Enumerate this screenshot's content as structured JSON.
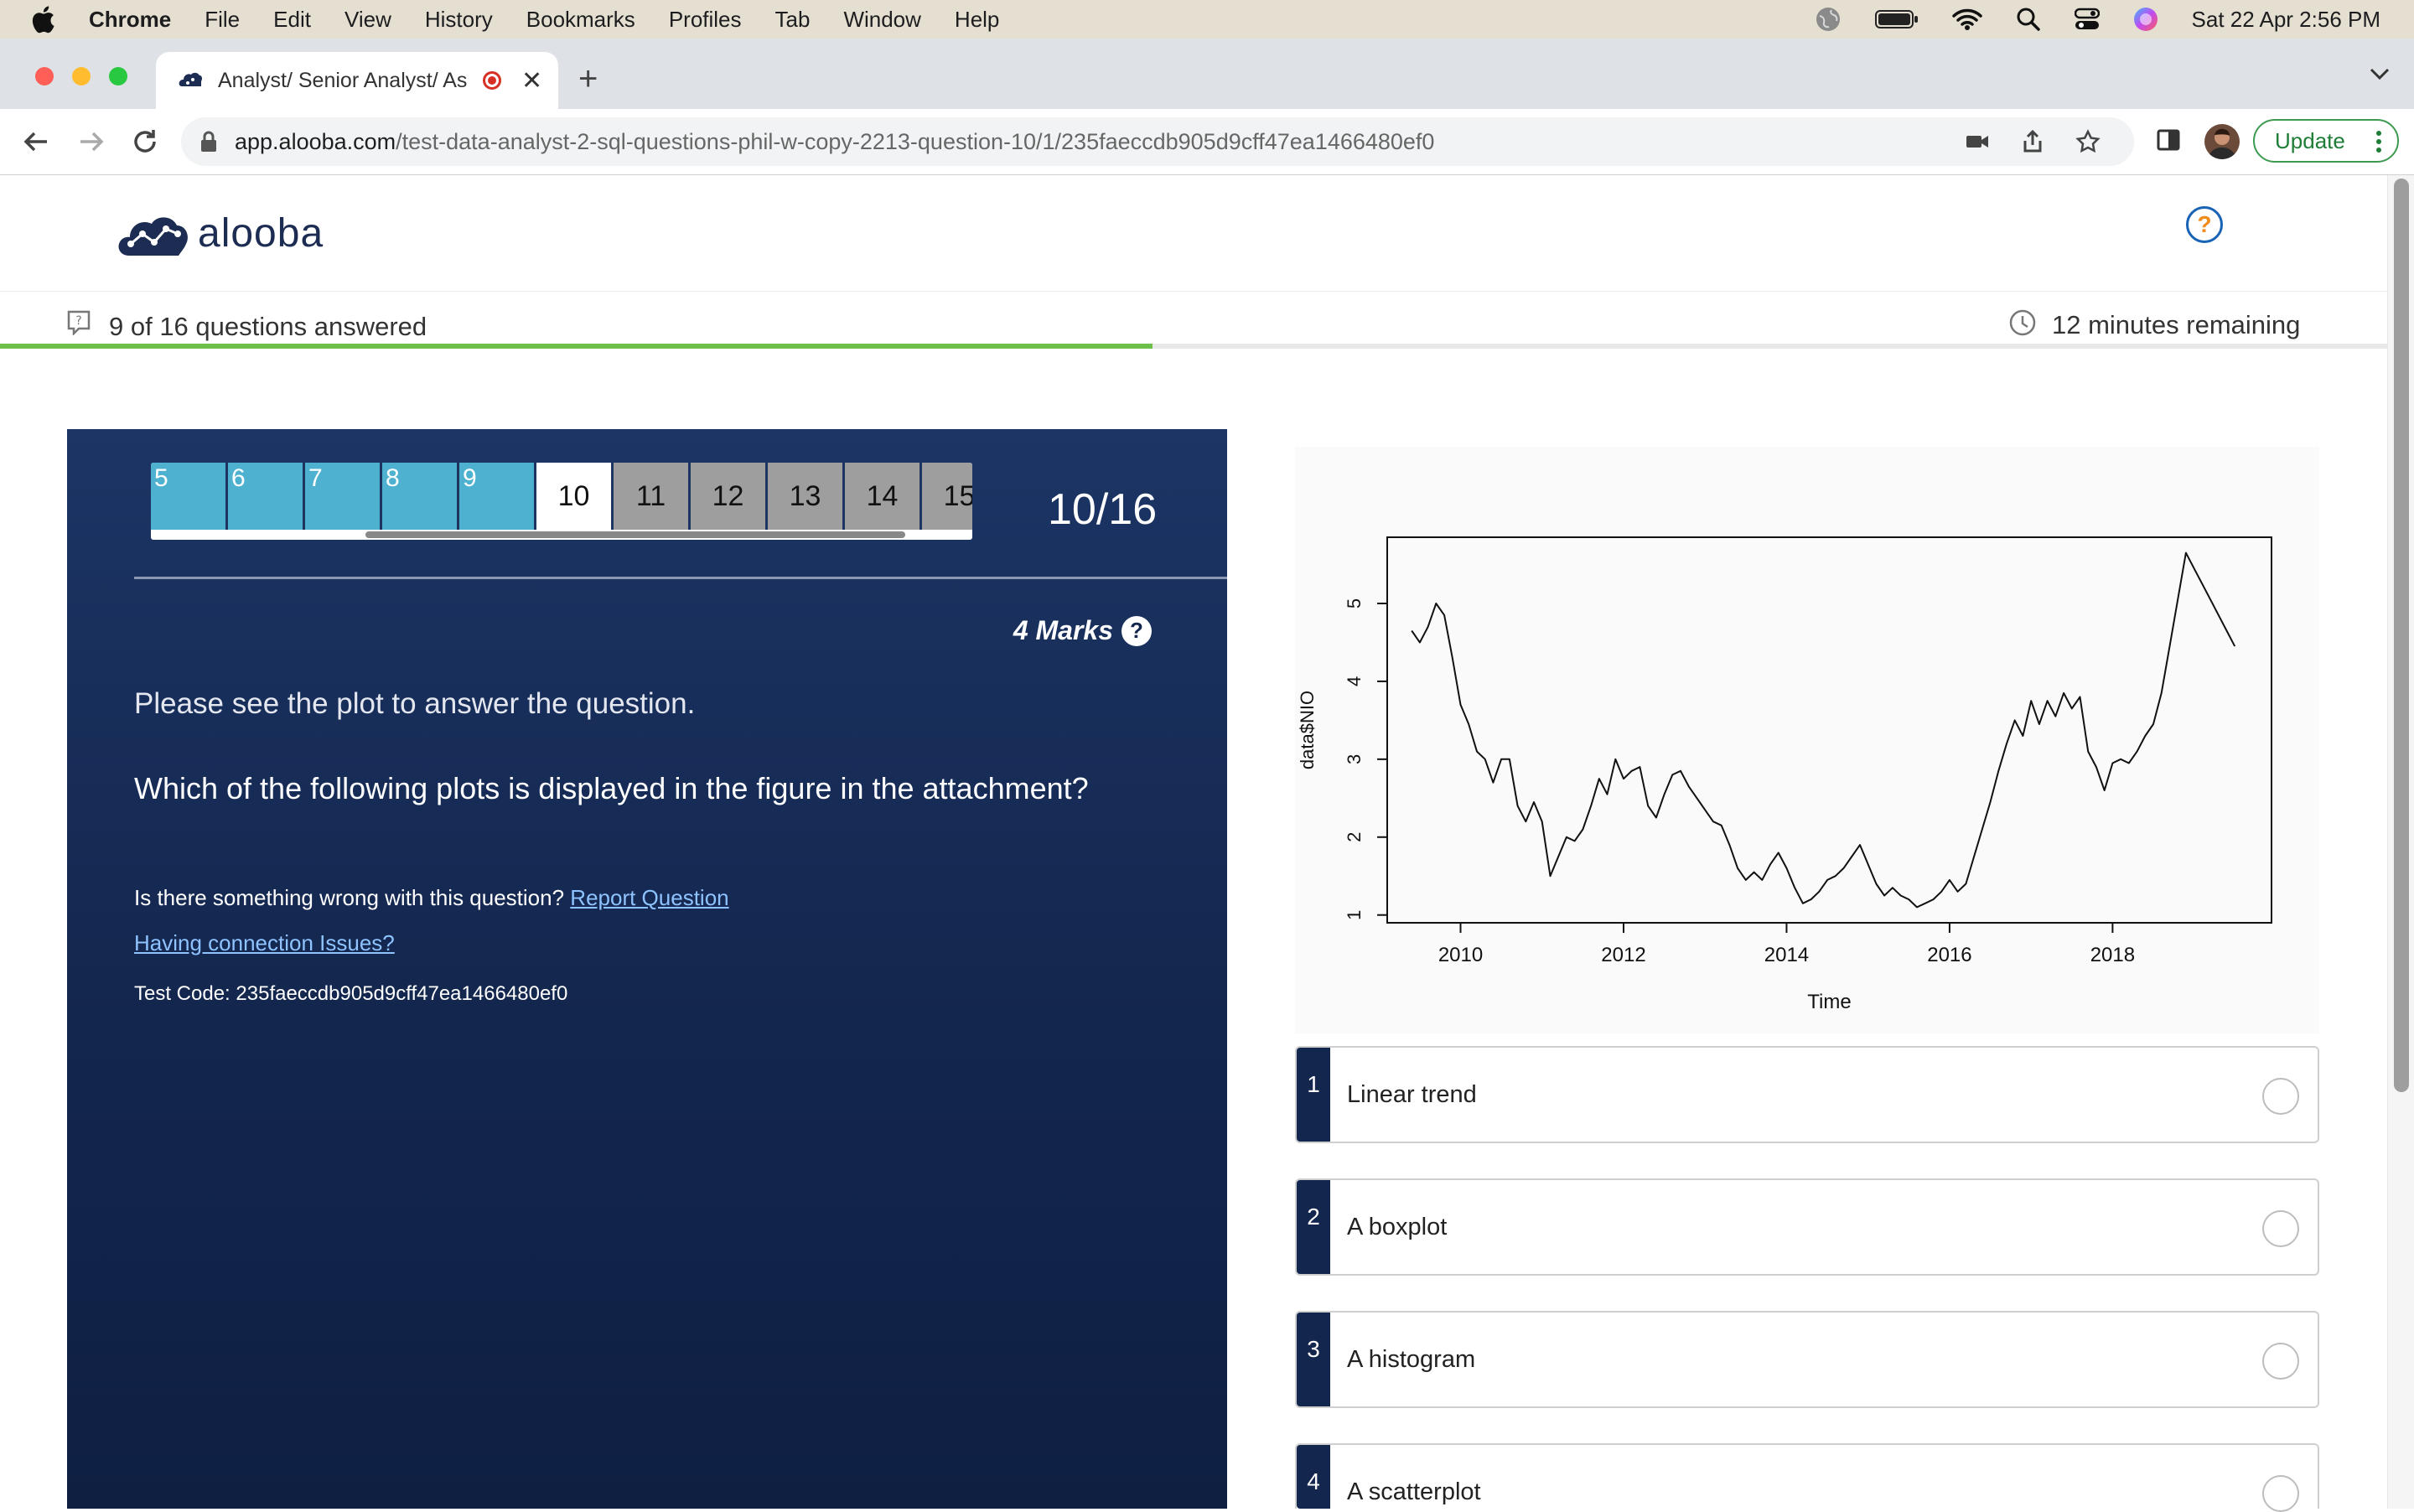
{
  "menubar": {
    "app_name": "Chrome",
    "items": [
      "File",
      "Edit",
      "View",
      "History",
      "Bookmarks",
      "Profiles",
      "Tab",
      "Window",
      "Help"
    ],
    "datetime": "Sat 22 Apr  2:56 PM"
  },
  "browser": {
    "tab_title": "Analyst/ Senior Analyst/ As",
    "url_host": "app.alooba.com",
    "url_path": "/test-data-analyst-2-sql-questions-phil-w-copy-2213-question-10/1/235faeccdb905d9cff47ea1466480ef0",
    "update_label": "Update"
  },
  "header": {
    "logo_text": "alooba",
    "help_symbol": "?"
  },
  "progress": {
    "answered_text": "9 of 16 questions answered",
    "remaining_text": "12 minutes remaining",
    "answered_fraction": 0.4827
  },
  "question_nav": {
    "done": [
      "5",
      "6",
      "7",
      "8",
      "9"
    ],
    "current": "10",
    "pending": [
      "11",
      "12",
      "13",
      "14",
      "15"
    ],
    "counter": "10/16"
  },
  "question": {
    "marks": "4 Marks",
    "intro": "Please see the plot to answer the question.",
    "text": "Which of the following plots is displayed in the figure in the attachment?",
    "report_prefix": "Is there something wrong with this question?",
    "report_link": "Report Question",
    "connection_link": "Having connection Issues?",
    "test_code": "Test Code: 235faeccdb905d9cff47ea1466480ef0"
  },
  "chart_data": {
    "type": "line",
    "title": "",
    "xlabel": "Time",
    "ylabel": "data$NIO",
    "xlim": [
      2009.1,
      2019.95
    ],
    "ylim": [
      0.9,
      5.85
    ],
    "xticks": [
      2010,
      2012,
      2014,
      2016,
      2018
    ],
    "yticks": [
      1,
      2,
      3,
      4,
      5
    ],
    "series": [
      {
        "x": [
          2009.4,
          2009.5,
          2009.6,
          2009.7,
          2009.8,
          2009.9,
          2010.0,
          2010.1,
          2010.2,
          2010.3,
          2010.4,
          2010.5,
          2010.6,
          2010.7,
          2010.8,
          2010.9,
          2011.0,
          2011.1,
          2011.2,
          2011.3,
          2011.4,
          2011.5,
          2011.6,
          2011.7,
          2011.8,
          2011.9,
          2012.0,
          2012.1,
          2012.2,
          2012.3,
          2012.4,
          2012.5,
          2012.6,
          2012.7,
          2012.8,
          2012.9,
          2013.0,
          2013.1,
          2013.2,
          2013.3,
          2013.4,
          2013.5,
          2013.6,
          2013.7,
          2013.8,
          2013.9,
          2014.0,
          2014.1,
          2014.2,
          2014.3,
          2014.4,
          2014.5,
          2014.6,
          2014.7,
          2014.8,
          2014.9,
          2015.0,
          2015.1,
          2015.2,
          2015.3,
          2015.4,
          2015.5,
          2015.6,
          2015.7,
          2015.8,
          2015.9,
          2016.0,
          2016.1,
          2016.2,
          2016.3,
          2016.4,
          2016.5,
          2016.6,
          2016.7,
          2016.8,
          2016.9,
          2017.0,
          2017.1,
          2017.2,
          2017.3,
          2017.4,
          2017.5,
          2017.6,
          2017.7,
          2017.8,
          2017.9,
          2018.0,
          2018.1,
          2018.2,
          2018.3,
          2018.4,
          2018.5,
          2018.6,
          2018.7,
          2018.8,
          2018.9,
          2019.0,
          2019.1,
          2019.2,
          2019.3,
          2019.4,
          2019.5
        ],
        "y": [
          4.65,
          4.5,
          4.7,
          5.0,
          4.85,
          4.3,
          3.7,
          3.45,
          3.1,
          3.0,
          2.7,
          3.0,
          3.0,
          2.4,
          2.2,
          2.45,
          2.2,
          1.5,
          1.75,
          2.0,
          1.95,
          2.1,
          2.4,
          2.75,
          2.55,
          3.0,
          2.75,
          2.85,
          2.9,
          2.4,
          2.25,
          2.55,
          2.8,
          2.85,
          2.65,
          2.5,
          2.35,
          2.2,
          2.15,
          1.9,
          1.6,
          1.45,
          1.55,
          1.45,
          1.65,
          1.8,
          1.6,
          1.35,
          1.15,
          1.2,
          1.3,
          1.45,
          1.5,
          1.6,
          1.75,
          1.9,
          1.65,
          1.4,
          1.25,
          1.35,
          1.25,
          1.2,
          1.1,
          1.15,
          1.2,
          1.3,
          1.45,
          1.3,
          1.4,
          1.75,
          2.1,
          2.45,
          2.85,
          3.2,
          3.5,
          3.3,
          3.75,
          3.45,
          3.75,
          3.55,
          3.85,
          3.65,
          3.8,
          3.1,
          2.9,
          2.6,
          2.95,
          3.0,
          2.95,
          3.1,
          3.3,
          3.45,
          3.85,
          4.45,
          5.05,
          5.65,
          5.45,
          5.25,
          5.05,
          4.85,
          4.65,
          4.45
        ]
      }
    ]
  },
  "options": [
    {
      "num": "1",
      "label": "Linear trend"
    },
    {
      "num": "2",
      "label": "A boxplot"
    },
    {
      "num": "3",
      "label": "A histogram"
    },
    {
      "num": "4",
      "label": "A scatterplot"
    }
  ],
  "colors": {
    "panel": "#13264d",
    "done_cell": "#4eb1cf",
    "pending_cell": "#9e9e9e",
    "progress": "#6cc04a",
    "link": "#8ec3ff"
  }
}
